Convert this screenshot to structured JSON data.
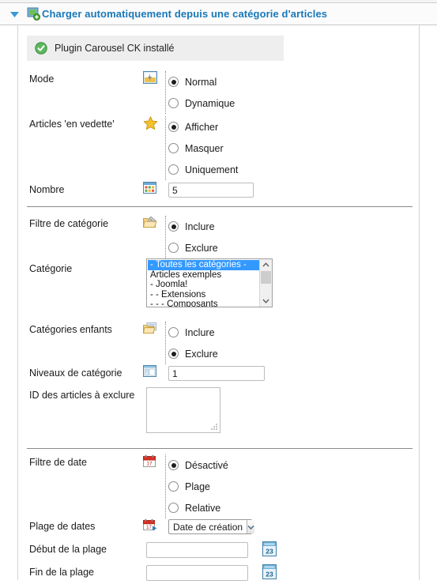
{
  "header": {
    "title": "Charger automatiquement depuis une catégorie d'articles",
    "twisty_icon": "triangle-down-icon",
    "panel_icon": "add-article-icon",
    "accent_color": "#1878b9"
  },
  "notice": {
    "icon": "check-circle-icon",
    "text": "Plugin Carousel CK installé",
    "background": "#eeeeee",
    "icon_color": "#3faa3f"
  },
  "fields": {
    "mode": {
      "label": "Mode",
      "icon": "mode-window-icon",
      "options": [
        {
          "label": "Normal",
          "selected": true
        },
        {
          "label": "Dynamique",
          "selected": false
        }
      ]
    },
    "featured": {
      "label": "Articles 'en vedette'",
      "icon": "star-icon",
      "options": [
        {
          "label": "Afficher",
          "selected": true
        },
        {
          "label": "Masquer",
          "selected": false
        },
        {
          "label": "Uniquement",
          "selected": false
        }
      ]
    },
    "count": {
      "label": "Nombre",
      "icon": "grid-number-icon",
      "value": "5",
      "placeholder": ""
    },
    "category_filter": {
      "label": "Filtre de catégorie",
      "icon": "folder-edit-icon",
      "options": [
        {
          "label": "Inclure",
          "selected": true
        },
        {
          "label": "Exclure",
          "selected": false
        }
      ]
    },
    "category": {
      "label": "Catégorie",
      "items": [
        {
          "label": "- Toutes les catégories -",
          "selected": true
        },
        {
          "label": "Articles exemples",
          "selected": false
        },
        {
          "label": "- Joomla!",
          "selected": false
        },
        {
          "label": "- - Extensions",
          "selected": false
        },
        {
          "label": "- - - Composants",
          "selected": false
        }
      ],
      "scroll_up_icon": "chevron-up-icon",
      "scroll_down_icon": "chevron-down-icon",
      "selection_color": "#3399ff"
    },
    "child_categories": {
      "label": "Catégories enfants",
      "icon": "folders-icon",
      "options": [
        {
          "label": "Inclure",
          "selected": false
        },
        {
          "label": "Exclure",
          "selected": true
        }
      ]
    },
    "category_levels": {
      "label": "Niveaux de catégorie",
      "icon": "levels-icon",
      "value": "1",
      "placeholder": ""
    },
    "exclude_ids": {
      "label": "ID des articles à exclure",
      "value": "",
      "placeholder": "",
      "resize_grip_icon": "resize-grip-icon"
    },
    "date_filter": {
      "label": "Filtre de date",
      "icon": "calendar-red-icon",
      "options": [
        {
          "label": "Désactivé",
          "selected": true
        },
        {
          "label": "Plage",
          "selected": false
        },
        {
          "label": "Relative",
          "selected": false
        }
      ]
    },
    "date_range": {
      "label": "Plage de dates",
      "icon": "calendar-range-icon",
      "value": "Date de création",
      "dropdown_icon": "chevron-down-icon",
      "options": [
        "Date de création"
      ]
    },
    "range_start": {
      "label": "Début de la plage",
      "value": "",
      "placeholder": "",
      "picker_icon": "calendar-23-icon"
    },
    "range_end": {
      "label": "Fin de la plage",
      "value": "",
      "placeholder": "",
      "picker_icon": "calendar-23-icon"
    }
  }
}
